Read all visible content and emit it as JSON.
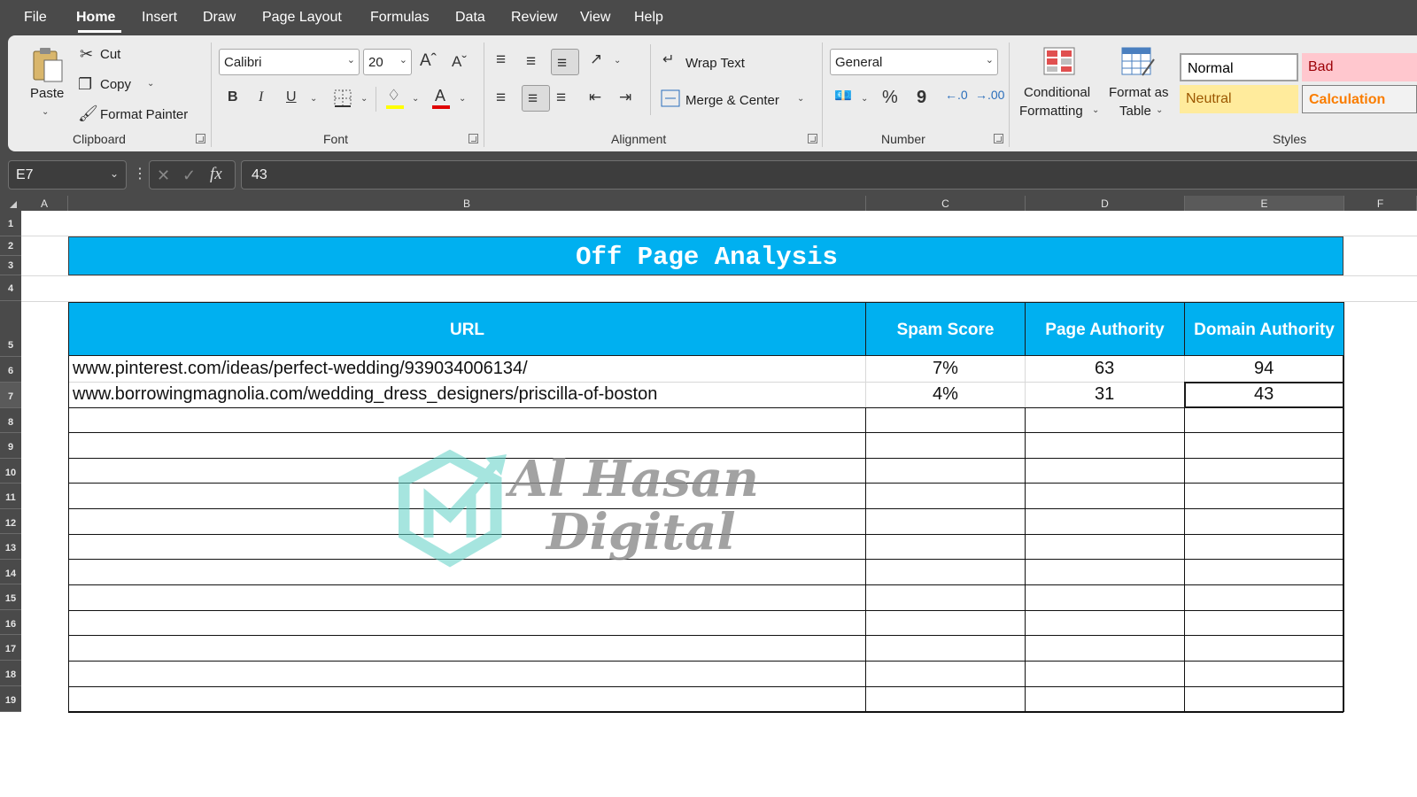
{
  "menu": {
    "items": [
      "File",
      "Home",
      "Insert",
      "Draw",
      "Page Layout",
      "Formulas",
      "Data",
      "Review",
      "View",
      "Help"
    ],
    "active": "Home"
  },
  "ribbon": {
    "clipboard": {
      "paste": "Paste",
      "cut": "Cut",
      "copy": "Copy",
      "format_painter": "Format Painter",
      "label": "Clipboard"
    },
    "font": {
      "name": "Calibri",
      "size": "20",
      "bold": "B",
      "italic": "I",
      "underline": "U",
      "label": "Font"
    },
    "alignment": {
      "wrap_text": "Wrap Text",
      "merge_center": "Merge & Center",
      "label": "Alignment"
    },
    "number": {
      "format": "General",
      "percent": "%",
      "comma": "9",
      "label": "Number"
    },
    "styles": {
      "conditional_formatting_1": "Conditional",
      "conditional_formatting_2": "Formatting",
      "format_as_table_1": "Format as",
      "format_as_table_2": "Table",
      "normal": "Normal",
      "bad": "Bad",
      "neutral": "Neutral",
      "calculation": "Calculation",
      "label": "Styles"
    }
  },
  "formula_bar": {
    "cell_ref": "E7",
    "fx": "fx",
    "value": "43"
  },
  "columns": [
    "A",
    "B",
    "C",
    "D",
    "E",
    "F"
  ],
  "rows": [
    "1",
    "2",
    "3",
    "4",
    "5",
    "6",
    "7",
    "8",
    "9",
    "10",
    "11",
    "12",
    "13",
    "14",
    "15",
    "16",
    "17",
    "18",
    "19"
  ],
  "sheet": {
    "title": "Off Page Analysis",
    "headers": {
      "url": "URL",
      "spam": "Spam Score",
      "pa": "Page Authority",
      "da": "Domain Authority"
    },
    "data_rows": [
      {
        "url": "www.pinterest.com/ideas/perfect-wedding/939034006134/",
        "spam": "7%",
        "pa": "63",
        "da": "94"
      },
      {
        "url": "www.borrowingmagnolia.com/wedding_dress_designers/priscilla-of-boston",
        "spam": "4%",
        "pa": "31",
        "da": "43"
      }
    ]
  },
  "watermark": {
    "line1": "Al Hasan",
    "line2": "Digital"
  },
  "colors": {
    "header_blue": "#00b0f0",
    "ribbon": "#ececec",
    "chrome": "#4a4a4a"
  }
}
